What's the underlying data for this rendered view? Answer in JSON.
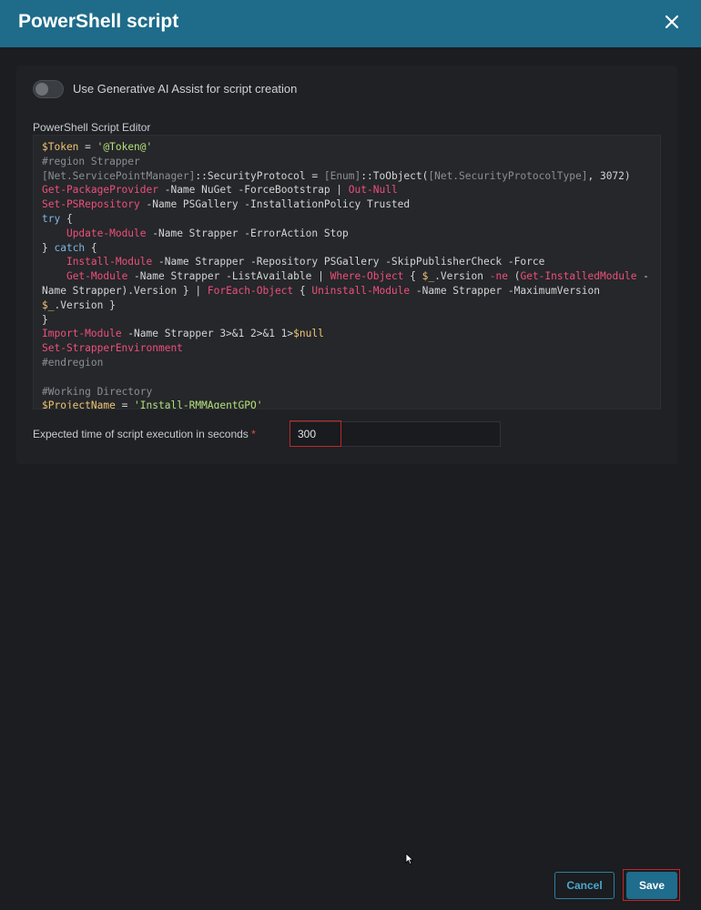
{
  "header": {
    "title": "PowerShell script",
    "close_icon": "close-icon"
  },
  "ai_toggle": {
    "label": "Use Generative AI Assist for script creation",
    "enabled": false
  },
  "editor": {
    "label": "PowerShell Script Editor",
    "lines": [
      "$Token = '@Token@'",
      "#region Strapper",
      "[Net.ServicePointManager]::SecurityProtocol = [Enum]::ToObject([Net.SecurityProtocolType], 3072)",
      "Get-PackageProvider -Name NuGet -ForceBootstrap | Out-Null",
      "Set-PSRepository -Name PSGallery -InstallationPolicy Trusted",
      "try {",
      "    Update-Module -Name Strapper -ErrorAction Stop",
      "} catch {",
      "    Install-Module -Name Strapper -Repository PSGallery -SkipPublisherCheck -Force",
      "    Get-Module -Name Strapper -ListAvailable | Where-Object { $_.Version -ne (Get-InstalledModule -",
      "Name Strapper).Version } | ForEach-Object { Uninstall-Module -Name Strapper -MaximumVersion",
      "$_.Version }",
      "}",
      "Import-Module -Name Strapper 3>&1 2>&1 1>$null",
      "Set-StrapperEnvironment",
      "#endregion",
      "",
      "#Working Directory",
      "$ProjectName = 'Install-RMMAgentGPO'"
    ]
  },
  "execution_time": {
    "label": "Expected time of script execution in seconds",
    "required_mark": "*",
    "value": "300"
  },
  "footer": {
    "cancel_label": "Cancel",
    "save_label": "Save"
  },
  "colors": {
    "header": "#1e6c8a",
    "accent": "#2f7ea0",
    "background": "#1b1d20"
  }
}
